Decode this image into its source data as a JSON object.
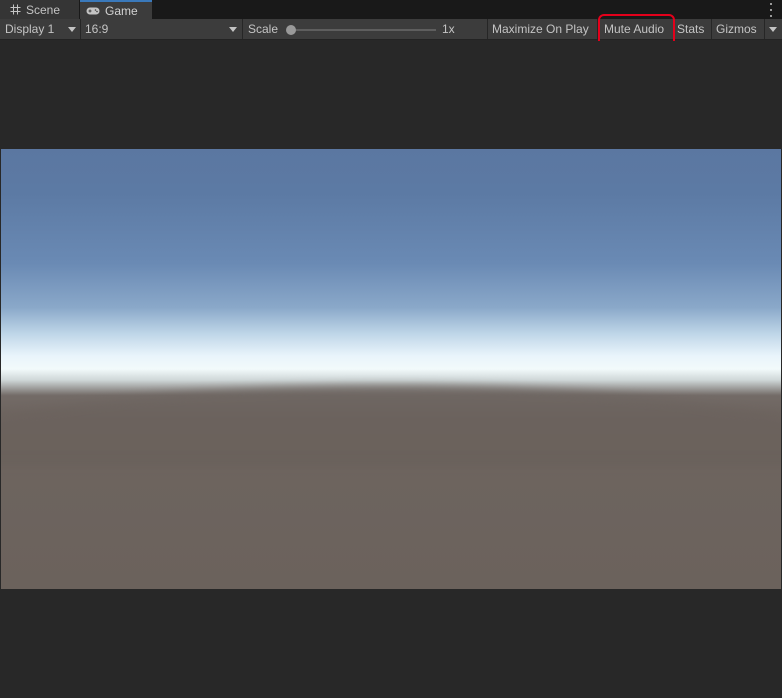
{
  "tabs": {
    "scene": {
      "label": "Scene",
      "icon": "grid-hash-icon"
    },
    "game": {
      "label": "Game",
      "icon": "gamepad-icon"
    }
  },
  "toolbar": {
    "display": {
      "value": "Display 1"
    },
    "aspect": {
      "value": "16:9"
    },
    "scale": {
      "label": "Scale",
      "value_label": "1x",
      "value": 1
    },
    "maximize_on_play": "Maximize On Play",
    "mute_audio": "Mute Audio",
    "stats": "Stats",
    "gizmos": "Gizmos"
  },
  "colors": {
    "highlight": "#e4001b",
    "active_tab_accent": "#3a79bb"
  }
}
